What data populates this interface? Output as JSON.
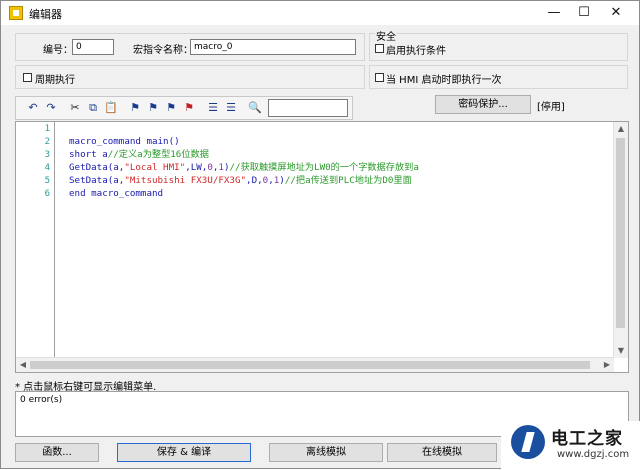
{
  "window": {
    "title": "编辑器",
    "controls": {
      "minimize": "—",
      "maximize": "☐",
      "close": "✕"
    }
  },
  "form": {
    "number_label": "编号：",
    "number_value": "0",
    "macro_name_label": "宏指令名称：",
    "macro_name_value": "macro_0",
    "security_title": "安全",
    "enable_condition_label": "启用执行条件",
    "periodic_label": "周期执行",
    "run_once_label": "当 HMI 启动时即执行一次"
  },
  "toolbar": {
    "icons": [
      "undo-icon",
      "redo-icon",
      "cut-icon",
      "copy-icon",
      "paste-icon",
      "bookmark-toggle-icon",
      "bookmark-prev-icon",
      "bookmark-next-icon",
      "bookmark-clear-icon",
      "indent-icon",
      "outdent-icon",
      "find-icon"
    ],
    "search_value": ""
  },
  "password": {
    "button_label": "密码保护...",
    "status": "[停用]"
  },
  "code": {
    "line_numbers": [
      "1",
      "2",
      "3",
      "4",
      "5",
      "6"
    ],
    "lines": [
      "",
      "macro_command main()",
      "short a//定义a为整型16位数据",
      "GetData(a,\"Local HMI\",LW,0,1)//获取触摸屏地址为LW0的一个字数据存放到a",
      "SetData(a,\"Mitsubishi FX3U/FX3G\",D,0,1)//把a传送到PLC地址为D0里面",
      "end macro_command"
    ]
  },
  "hint": "* 点击鼠标右键可显示编辑菜单.",
  "output": {
    "text": "0 error(s)"
  },
  "bottom_buttons": {
    "functions": "函数...",
    "save_compile": "保存 & 编译",
    "offline_sim": "离线模拟",
    "online_sim": "在线模拟"
  },
  "watermark": {
    "title": "电工之家",
    "url": "www.dgzj.com"
  }
}
